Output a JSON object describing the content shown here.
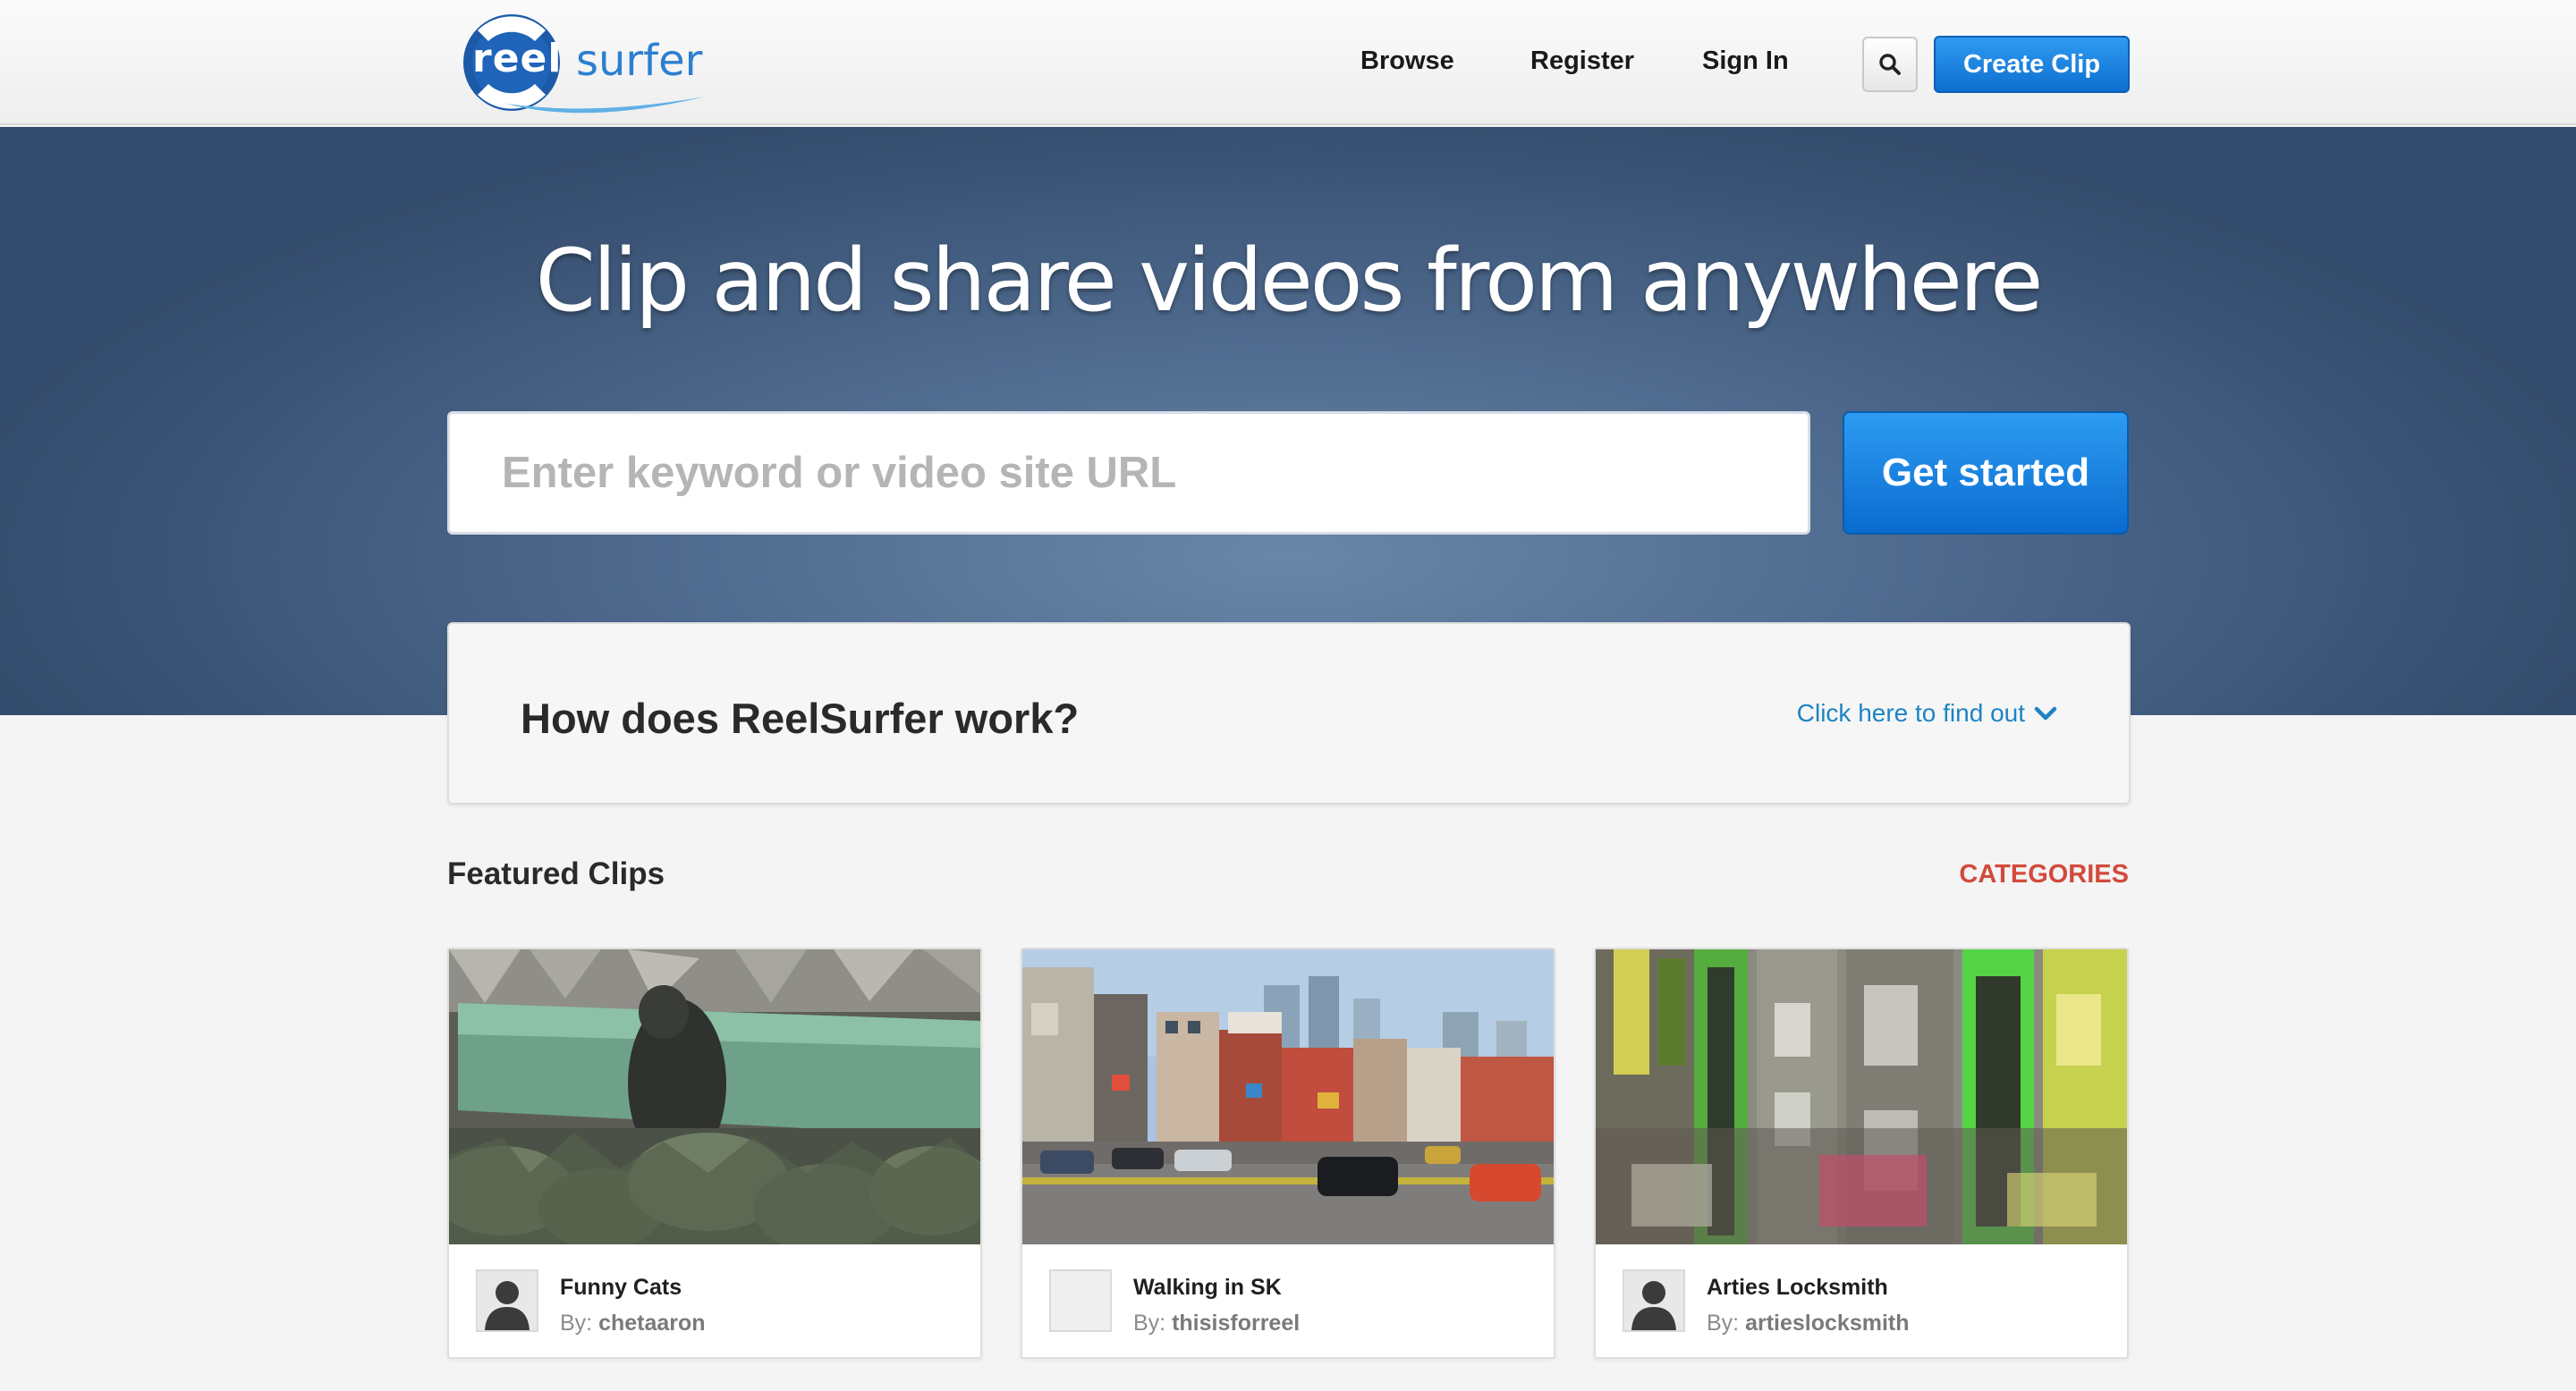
{
  "header": {
    "logo": {
      "reel": "reel",
      "surfer": "surfer"
    },
    "nav": [
      {
        "label": "Browse"
      },
      {
        "label": "Register"
      },
      {
        "label": "Sign In"
      }
    ],
    "search_icon": "search-icon",
    "create_clip_label": "Create Clip"
  },
  "hero": {
    "title": "Clip and share videos from anywhere",
    "search_placeholder": "Enter keyword or video site URL",
    "search_value": "",
    "cta_label": "Get started"
  },
  "how": {
    "title": "How does ReelSurfer work?",
    "link_label": "Click here to find out",
    "link_icon": "chevron-down-icon"
  },
  "featured": {
    "title": "Featured Clips",
    "categories_label": "CATEGORIES",
    "clips": [
      {
        "title": "Funny Cats",
        "by_label": "By:",
        "author": "chetaaron",
        "avatar": "user-silhouette"
      },
      {
        "title": "Walking in SK",
        "by_label": "By:",
        "author": "thisisforreel",
        "avatar": "blank"
      },
      {
        "title": "Arties Locksmith",
        "by_label": "By:",
        "author": "artieslocksmith",
        "avatar": "user-silhouette"
      }
    ]
  },
  "colors": {
    "primary_blue": "#1576d8",
    "link_blue": "#1d84c4",
    "categories_red": "#d24a3d",
    "hero_bg": "#4f6b8f"
  }
}
